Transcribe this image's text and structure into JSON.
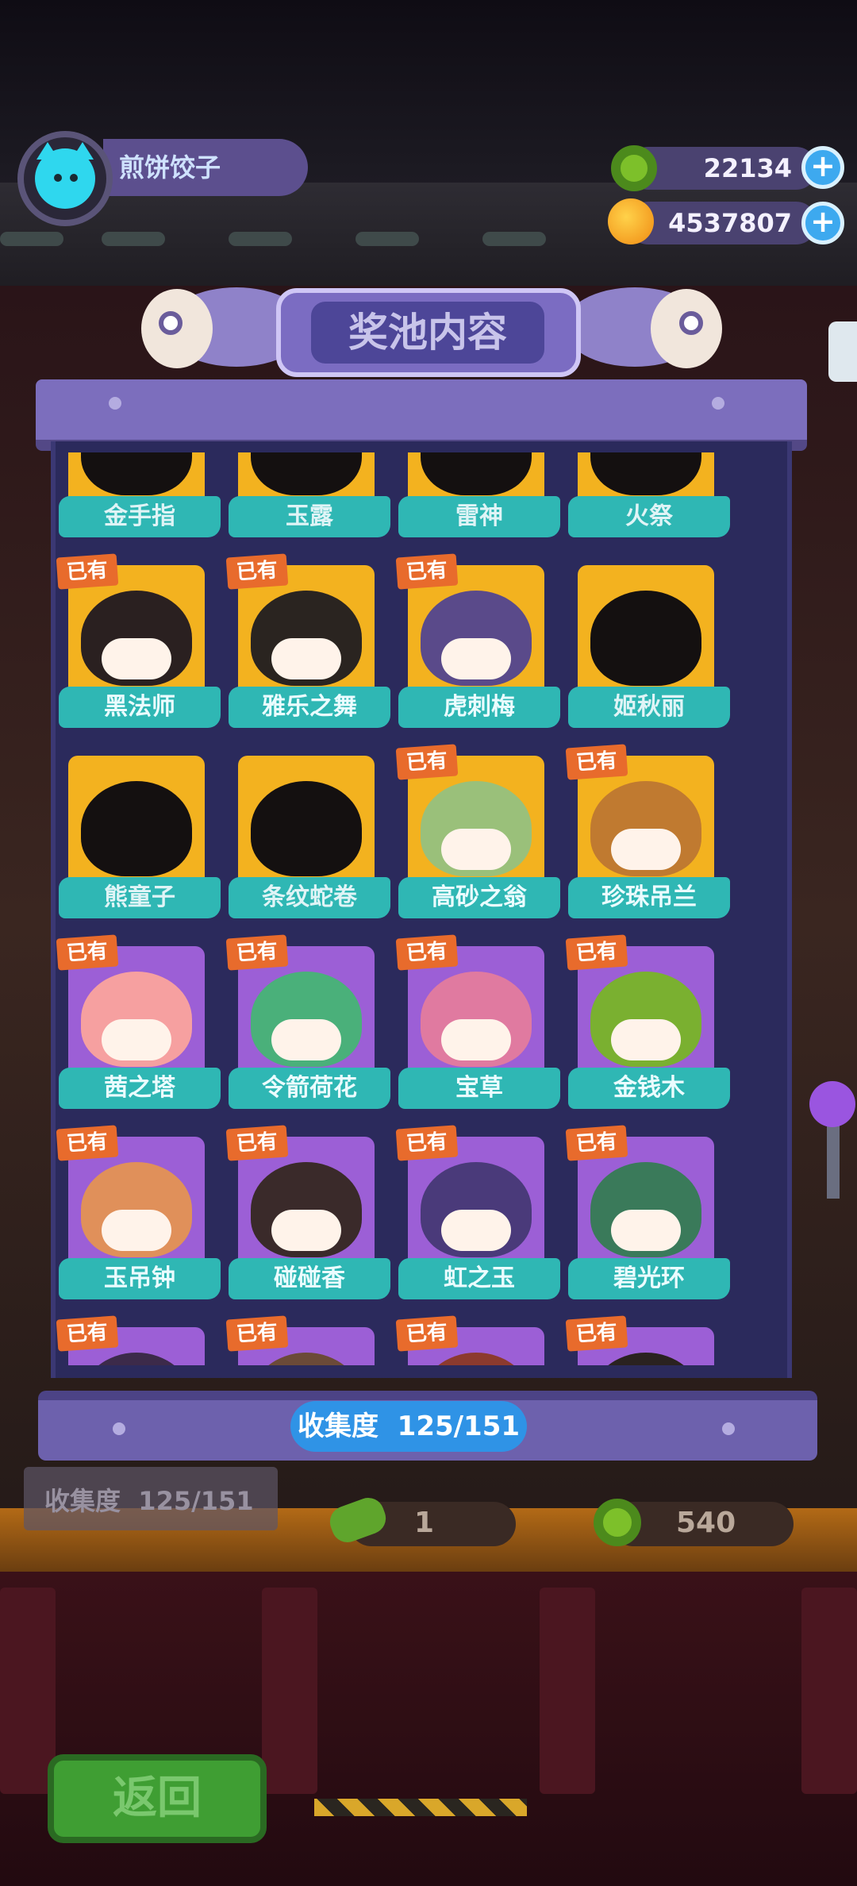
{
  "header": {
    "player_name": "煎饼饺子",
    "currency_green": "22134",
    "currency_orange": "4537807",
    "plus_label": "+"
  },
  "panel": {
    "title": "奖池内容",
    "collection_label": "收集度",
    "collection_value": "125/151"
  },
  "owned_badge": "已有",
  "items": [
    {
      "name": "金手指",
      "owned": false,
      "bg": "gold"
    },
    {
      "name": "玉露",
      "owned": false,
      "bg": "gold"
    },
    {
      "name": "雷神",
      "owned": false,
      "bg": "gold"
    },
    {
      "name": "火祭",
      "owned": false,
      "bg": "gold"
    },
    {
      "name": "黑法师",
      "owned": true,
      "bg": "gold"
    },
    {
      "name": "雅乐之舞",
      "owned": true,
      "bg": "gold"
    },
    {
      "name": "虎刺梅",
      "owned": true,
      "bg": "gold"
    },
    {
      "name": "姬秋丽",
      "owned": false,
      "bg": "gold"
    },
    {
      "name": "熊童子",
      "owned": false,
      "bg": "gold"
    },
    {
      "name": "条纹蛇卷",
      "owned": false,
      "bg": "gold"
    },
    {
      "name": "高砂之翁",
      "owned": true,
      "bg": "gold"
    },
    {
      "name": "珍珠吊兰",
      "owned": true,
      "bg": "gold"
    },
    {
      "name": "茜之塔",
      "owned": true,
      "bg": "purple"
    },
    {
      "name": "令箭荷花",
      "owned": true,
      "bg": "purple"
    },
    {
      "name": "宝草",
      "owned": true,
      "bg": "purple"
    },
    {
      "name": "金钱木",
      "owned": true,
      "bg": "purple"
    },
    {
      "name": "玉吊钟",
      "owned": true,
      "bg": "purple"
    },
    {
      "name": "碰碰香",
      "owned": true,
      "bg": "purple"
    },
    {
      "name": "虹之玉",
      "owned": true,
      "bg": "purple"
    },
    {
      "name": "碧光环",
      "owned": true,
      "bg": "purple"
    },
    {
      "name": "",
      "owned": true,
      "bg": "purple"
    },
    {
      "name": "",
      "owned": true,
      "bg": "purple"
    },
    {
      "name": "",
      "owned": true,
      "bg": "purple"
    },
    {
      "name": "",
      "owned": true,
      "bg": "purple"
    }
  ],
  "background": {
    "collection_label": "收集度",
    "collection_value": "125/151",
    "price_single": "1",
    "price_bulk": "540"
  },
  "footer": {
    "back_label": "返回"
  },
  "colors": {
    "panel": "#2b2a5c",
    "label_teal": "#2fb7b4",
    "badge_orange": "#e86b2c",
    "card_gold": "#f3b21f",
    "card_purple": "#9c5fd6",
    "collection_blue": "#2f93e6"
  }
}
